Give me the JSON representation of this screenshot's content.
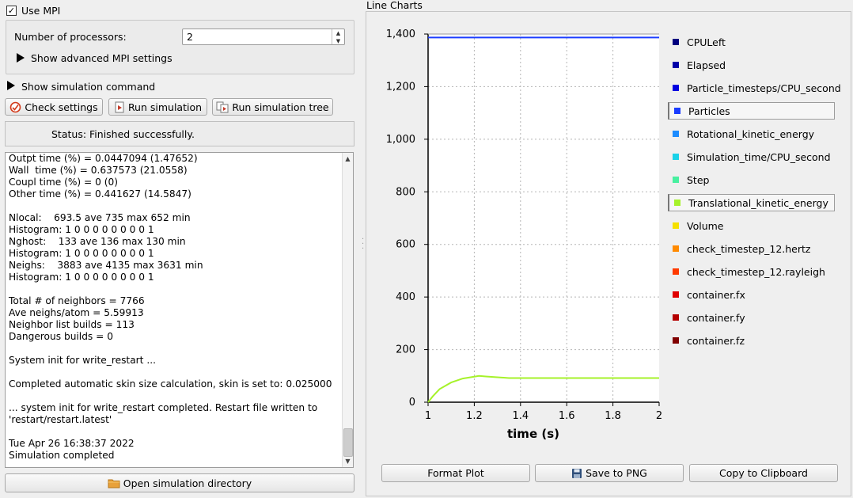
{
  "left": {
    "use_mpi": {
      "label": "Use MPI",
      "checked": true
    },
    "processors": {
      "label": "Number of processors:",
      "value": "2"
    },
    "advanced_mpi": "Show advanced MPI settings",
    "show_command": "Show simulation command",
    "buttons": {
      "check": "Check settings",
      "run": "Run simulation",
      "run_tree": "Run simulation tree",
      "open_dir": "Open simulation directory"
    },
    "status": "Status: Finished successfully.",
    "log": [
      "Outpt time (%) = 0.0447094 (1.47652)",
      "Wall  time (%) = 0.637573 (21.0558)",
      "Coupl time (%) = 0 (0)",
      "Other time (%) = 0.441627 (14.5847)",
      "",
      "Nlocal:    693.5 ave 735 max 652 min",
      "Histogram: 1 0 0 0 0 0 0 0 0 1",
      "Nghost:    133 ave 136 max 130 min",
      "Histogram: 1 0 0 0 0 0 0 0 0 1",
      "Neighs:    3883 ave 4135 max 3631 min",
      "Histogram: 1 0 0 0 0 0 0 0 0 1",
      "",
      "Total # of neighbors = 7766",
      "Ave neighs/atom = 5.59913",
      "Neighbor list builds = 113",
      "Dangerous builds = 0",
      "",
      "System init for write_restart ...",
      "",
      "Completed automatic skin size calculation, skin is set to: 0.025000",
      "",
      "... system init for write_restart completed. Restart file written to",
      "'restart/restart.latest'",
      "",
      "Tue Apr 26 16:38:37 2022",
      "Simulation completed"
    ]
  },
  "right": {
    "panel_title": "Line Charts",
    "buttons": {
      "format": "Format Plot",
      "save": "Save to PNG",
      "copy": "Copy to Clipboard"
    }
  },
  "chart_data": {
    "type": "line",
    "xlabel": "time (s)",
    "ylabel": "",
    "xlim": [
      1,
      2
    ],
    "ylim": [
      0,
      1400
    ],
    "x_ticks": [
      "1",
      "1.2",
      "1.4",
      "1.6",
      "1.8",
      "2"
    ],
    "y_ticks": [
      "0",
      "200",
      "400",
      "600",
      "800",
      "1,000",
      "1,200",
      "1,400"
    ],
    "grid": true,
    "legend_placement": "right",
    "legend": [
      {
        "name": "CPULeft",
        "color": "#00007f",
        "selected": false
      },
      {
        "name": "Elapsed",
        "color": "#0000a8",
        "selected": false
      },
      {
        "name": "Particle_timesteps/CPU_second",
        "color": "#0000e0",
        "selected": false
      },
      {
        "name": "Particles",
        "color": "#1a3cff",
        "selected": true
      },
      {
        "name": "Rotational_kinetic_energy",
        "color": "#1c8cff",
        "selected": false
      },
      {
        "name": "Simulation_time/CPU_second",
        "color": "#1ad2e8",
        "selected": false
      },
      {
        "name": "Step",
        "color": "#48f0a0",
        "selected": false
      },
      {
        "name": "Translational_kinetic_energy",
        "color": "#a6f22a",
        "selected": true
      },
      {
        "name": "Volume",
        "color": "#f5e000",
        "selected": false
      },
      {
        "name": "check_timestep_12.hertz",
        "color": "#ff8a00",
        "selected": false
      },
      {
        "name": "check_timestep_12.rayleigh",
        "color": "#ff3a00",
        "selected": false
      },
      {
        "name": "container.fx",
        "color": "#e00000",
        "selected": false
      },
      {
        "name": "container.fy",
        "color": "#b40000",
        "selected": false
      },
      {
        "name": "container.fz",
        "color": "#800000",
        "selected": false
      }
    ],
    "series": [
      {
        "name": "Particles",
        "color": "#1a3cff",
        "x": [
          1.0,
          2.0
        ],
        "y": [
          1387,
          1387
        ]
      },
      {
        "name": "Translational_kinetic_energy",
        "color": "#a6f22a",
        "x": [
          1.0,
          1.02,
          1.05,
          1.1,
          1.15,
          1.2,
          1.22,
          1.25,
          1.3,
          1.35,
          1.5,
          1.7,
          2.0
        ],
        "y": [
          0,
          22,
          50,
          75,
          90,
          97,
          100,
          98,
          95,
          92,
          92,
          92,
          92
        ]
      }
    ]
  }
}
